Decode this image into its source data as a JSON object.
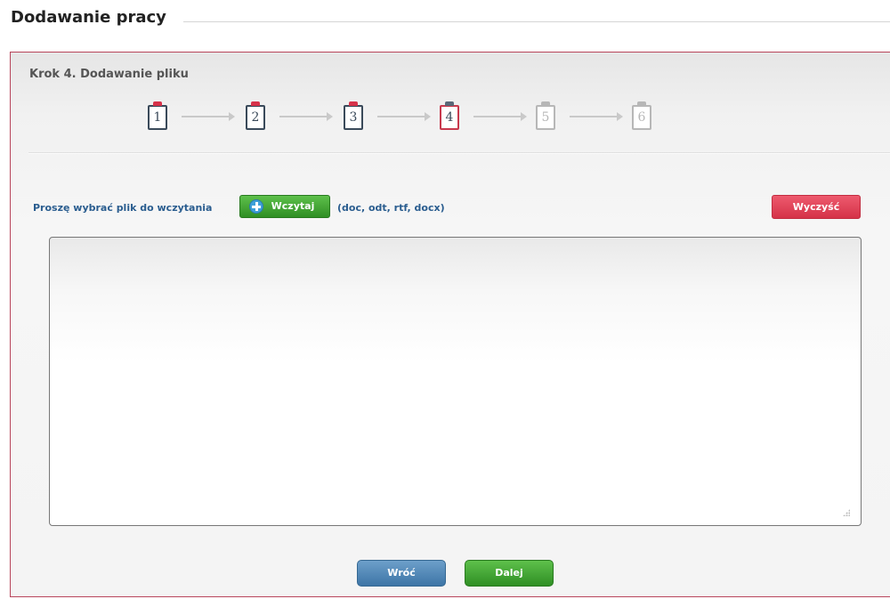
{
  "page": {
    "title": "Dodawanie pracy"
  },
  "wizard": {
    "step_heading": "Krok 4. Dodawanie pliku",
    "steps": [
      {
        "label": "1",
        "state": "done"
      },
      {
        "label": "2",
        "state": "done"
      },
      {
        "label": "3",
        "state": "done"
      },
      {
        "label": "4",
        "state": "current"
      },
      {
        "label": "5",
        "state": "future"
      },
      {
        "label": "6",
        "state": "future"
      }
    ]
  },
  "upload": {
    "prompt": "Proszę wybrać plik do wczytania",
    "load_label": "Wczytaj",
    "formats": "(doc, odt, rtf, docx)",
    "clear_label": "Wyczyść"
  },
  "editor": {
    "value": ""
  },
  "nav": {
    "back_label": "Wróć",
    "next_label": "Dalej"
  },
  "colors": {
    "panel_border": "#b8455b",
    "green_button": "#3a9a2e",
    "red_button": "#d53248",
    "blue_button": "#4a81b2",
    "link_text": "#2a5d8f"
  }
}
